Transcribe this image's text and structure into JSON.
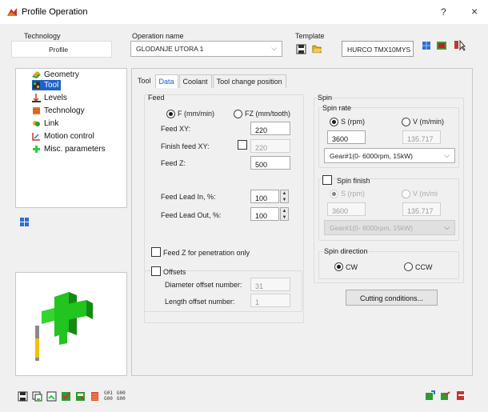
{
  "window": {
    "title": "Profile Operation",
    "help": "?",
    "close": "×"
  },
  "technology": {
    "label": "Technology",
    "value": "Profile"
  },
  "operation": {
    "label": "Operation name",
    "value": "GLODANJE UTORA 1"
  },
  "template": {
    "label": "Template",
    "machine": "HURCO TMX10MYS"
  },
  "tree": [
    {
      "label": "Geometry",
      "icon": "geometry-icon",
      "selected": false
    },
    {
      "label": "Tool",
      "icon": "tool-icon",
      "selected": true
    },
    {
      "label": "Levels",
      "icon": "levels-icon",
      "selected": false
    },
    {
      "label": "Technology",
      "icon": "technology-icon",
      "selected": false
    },
    {
      "label": "Link",
      "icon": "link-icon",
      "selected": false
    },
    {
      "label": "Motion control",
      "icon": "motion-control-icon",
      "selected": false
    },
    {
      "label": "Misc. parameters",
      "icon": "misc-parameters-icon",
      "selected": false
    }
  ],
  "tabs": [
    "Tool",
    "Data",
    "Coolant",
    "Tool change position"
  ],
  "feed": {
    "title": "Feed",
    "radio_f": "F (mm/min)",
    "radio_fz": "FZ (mm/tooth)",
    "feed_xy_label": "Feed XY:",
    "feed_xy": "220",
    "finish_feed_label": "Finish feed XY:",
    "finish_feed": "220",
    "feed_z_label": "Feed Z:",
    "feed_z": "500",
    "lead_in_label": "Feed Lead In, %:",
    "lead_in": "100",
    "lead_out_label": "Feed Lead Out, %:",
    "lead_out": "100",
    "penetration_label": "Feed Z for penetration only"
  },
  "offsets": {
    "title": "Offsets",
    "diameter_label": "Diameter offset number:",
    "diameter": "31",
    "length_label": "Length offset number:",
    "length": "1"
  },
  "spin": {
    "title": "Spin",
    "rate_title": "Spin rate",
    "radio_s": "S (rpm)",
    "radio_v": "V (m/min)",
    "s_value": "3600",
    "v_value": "135.717",
    "gear": "Gear#1(0- 6000rpm, 15kW)",
    "finish_title": "Spin finish",
    "finish_s": "S (rpm)",
    "finish_v": "V (m/mi",
    "finish_s_value": "3600",
    "finish_v_value": "135.717",
    "finish_gear": "Gear#1(0- 6000rpm, 15kW)",
    "direction_title": "Spin direction",
    "cw": "CW",
    "ccw": "CCW"
  },
  "cutting_button": "Cutting conditions...",
  "bottom_codes": {
    "code1": "G01",
    "code2": "G00",
    "code3": "G00",
    "code4": "G00"
  },
  "colors": {
    "accent": "#1f5fbf",
    "selection": "#1e62c9",
    "tool_green": "#22c41f"
  }
}
